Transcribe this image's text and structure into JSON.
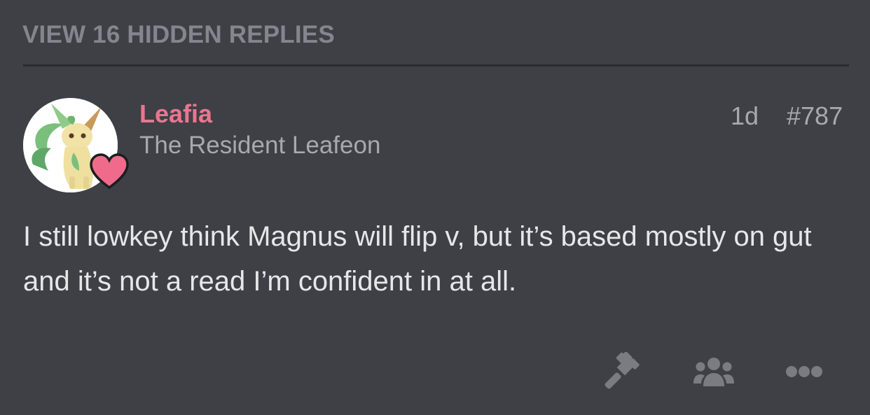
{
  "thread": {
    "hidden_replies_label": "VIEW 16 HIDDEN REPLIES"
  },
  "post": {
    "author": {
      "name": "Leafia",
      "title": "The Resident Leafeon",
      "avatar_icon": "leafeon-avatar",
      "badge_icon": "heart-icon",
      "name_color": "#e97690",
      "badge_color": "#f06b8b"
    },
    "age": "1d",
    "number": "#787",
    "body": "I still lowkey think Magnus will flip v, but it’s based mostly on gut and it’s not a read I’m confident in at all.",
    "actions": [
      {
        "icon": "gavel-icon"
      },
      {
        "icon": "users-icon"
      },
      {
        "icon": "more-icon"
      }
    ]
  },
  "colors": {
    "background": "#3e4046",
    "muted_text": "#a7a9ae",
    "body_text": "#e6e7ea",
    "icon": "#7a7c82"
  }
}
